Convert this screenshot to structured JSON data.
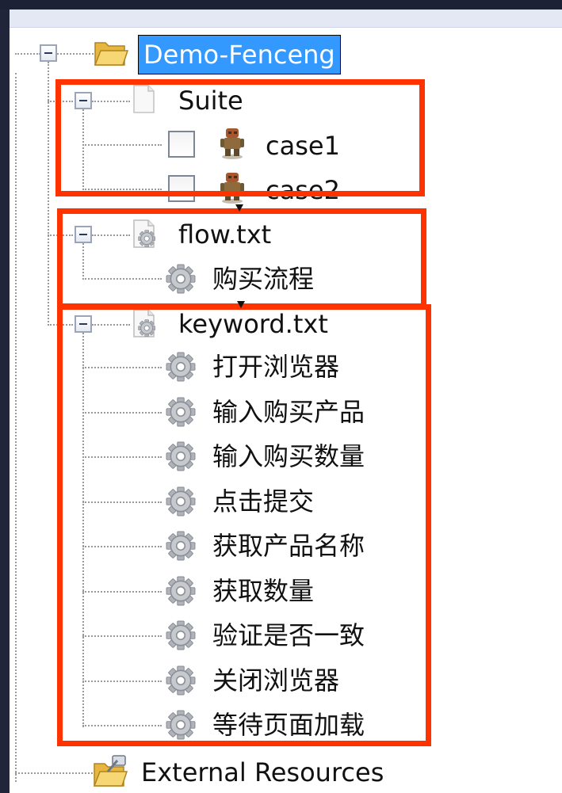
{
  "tree": {
    "root": {
      "label": "Demo-Fenceng",
      "icon": "folder-open-icon"
    },
    "suite": {
      "label": "Suite",
      "icon": "document-icon",
      "cases": [
        {
          "label": "case1",
          "icon": "robot-icon"
        },
        {
          "label": "case2",
          "icon": "robot-icon"
        }
      ]
    },
    "flow": {
      "label": "flow.txt",
      "icon": "gear-document-icon",
      "items": [
        {
          "label": "购买流程",
          "icon": "gear-icon"
        }
      ]
    },
    "keyword": {
      "label": "keyword.txt",
      "icon": "gear-document-icon",
      "items": [
        {
          "label": "打开浏览器",
          "icon": "gear-icon"
        },
        {
          "label": "输入购买产品",
          "icon": "gear-icon"
        },
        {
          "label": "输入购买数量",
          "icon": "gear-icon"
        },
        {
          "label": "点击提交",
          "icon": "gear-icon"
        },
        {
          "label": "获取产品名称",
          "icon": "gear-icon"
        },
        {
          "label": "获取数量",
          "icon": "gear-icon"
        },
        {
          "label": "验证是否一致",
          "icon": "gear-icon"
        },
        {
          "label": "关闭浏览器",
          "icon": "gear-icon"
        },
        {
          "label": "等待页面加载",
          "icon": "gear-icon"
        }
      ]
    },
    "external": {
      "label": "External Resources",
      "icon": "folder-external-icon"
    }
  },
  "colors": {
    "highlight": "#ff3300",
    "selection": "#3399ff",
    "background": "#ffffff"
  }
}
